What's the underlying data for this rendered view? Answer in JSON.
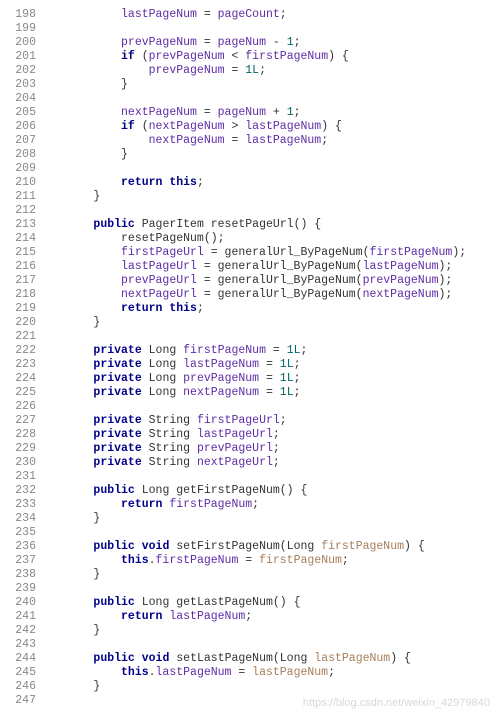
{
  "watermark": "https://blog.csdn.net/weixin_42979840",
  "lines": [
    {
      "num": "198",
      "tokens": [
        {
          "t": "          "
        },
        {
          "t": "lastPageNum",
          "c": "field"
        },
        {
          "t": " = "
        },
        {
          "t": "pageCount",
          "c": "field"
        },
        {
          "t": ";"
        }
      ]
    },
    {
      "num": "199",
      "tokens": []
    },
    {
      "num": "200",
      "tokens": [
        {
          "t": "          "
        },
        {
          "t": "prevPageNum",
          "c": "field"
        },
        {
          "t": " = "
        },
        {
          "t": "pageNum",
          "c": "field"
        },
        {
          "t": " - "
        },
        {
          "t": "1",
          "c": "num"
        },
        {
          "t": ";"
        }
      ]
    },
    {
      "num": "201",
      "tokens": [
        {
          "t": "          "
        },
        {
          "t": "if",
          "c": "kw"
        },
        {
          "t": " ("
        },
        {
          "t": "prevPageNum",
          "c": "field"
        },
        {
          "t": " < "
        },
        {
          "t": "firstPageNum",
          "c": "field"
        },
        {
          "t": ") {"
        }
      ]
    },
    {
      "num": "202",
      "tokens": [
        {
          "t": "              "
        },
        {
          "t": "prevPageNum",
          "c": "field"
        },
        {
          "t": " = "
        },
        {
          "t": "1L",
          "c": "num"
        },
        {
          "t": ";"
        }
      ]
    },
    {
      "num": "203",
      "tokens": [
        {
          "t": "          }"
        }
      ]
    },
    {
      "num": "204",
      "tokens": []
    },
    {
      "num": "205",
      "tokens": [
        {
          "t": "          "
        },
        {
          "t": "nextPageNum",
          "c": "field"
        },
        {
          "t": " = "
        },
        {
          "t": "pageNum",
          "c": "field"
        },
        {
          "t": " + "
        },
        {
          "t": "1",
          "c": "num"
        },
        {
          "t": ";"
        }
      ]
    },
    {
      "num": "206",
      "tokens": [
        {
          "t": "          "
        },
        {
          "t": "if",
          "c": "kw"
        },
        {
          "t": " ("
        },
        {
          "t": "nextPageNum",
          "c": "field"
        },
        {
          "t": " > "
        },
        {
          "t": "lastPageNum",
          "c": "field"
        },
        {
          "t": ") {"
        }
      ]
    },
    {
      "num": "207",
      "tokens": [
        {
          "t": "              "
        },
        {
          "t": "nextPageNum",
          "c": "field"
        },
        {
          "t": " = "
        },
        {
          "t": "lastPageNum",
          "c": "field"
        },
        {
          "t": ";"
        }
      ]
    },
    {
      "num": "208",
      "tokens": [
        {
          "t": "          }"
        }
      ]
    },
    {
      "num": "209",
      "tokens": []
    },
    {
      "num": "210",
      "tokens": [
        {
          "t": "          "
        },
        {
          "t": "return",
          "c": "kw"
        },
        {
          "t": " "
        },
        {
          "t": "this",
          "c": "kw"
        },
        {
          "t": ";"
        }
      ]
    },
    {
      "num": "211",
      "tokens": [
        {
          "t": "      }"
        }
      ]
    },
    {
      "num": "212",
      "tokens": []
    },
    {
      "num": "213",
      "tokens": [
        {
          "t": "      "
        },
        {
          "t": "public",
          "c": "kw"
        },
        {
          "t": " PagerItem resetPageUrl() {"
        }
      ]
    },
    {
      "num": "214",
      "tokens": [
        {
          "t": "          resetPageNum();"
        }
      ]
    },
    {
      "num": "215",
      "tokens": [
        {
          "t": "          "
        },
        {
          "t": "firstPageUrl",
          "c": "field"
        },
        {
          "t": " = generalUrl_ByPageNum("
        },
        {
          "t": "firstPageNum",
          "c": "field"
        },
        {
          "t": ");"
        }
      ]
    },
    {
      "num": "216",
      "tokens": [
        {
          "t": "          "
        },
        {
          "t": "lastPageUrl",
          "c": "field"
        },
        {
          "t": " = generalUrl_ByPageNum("
        },
        {
          "t": "lastPageNum",
          "c": "field"
        },
        {
          "t": ");"
        }
      ]
    },
    {
      "num": "217",
      "tokens": [
        {
          "t": "          "
        },
        {
          "t": "prevPageUrl",
          "c": "field"
        },
        {
          "t": " = generalUrl_ByPageNum("
        },
        {
          "t": "prevPageNum",
          "c": "field"
        },
        {
          "t": ");"
        }
      ]
    },
    {
      "num": "218",
      "tokens": [
        {
          "t": "          "
        },
        {
          "t": "nextPageUrl",
          "c": "field"
        },
        {
          "t": " = generalUrl_ByPageNum("
        },
        {
          "t": "nextPageNum",
          "c": "field"
        },
        {
          "t": ");"
        }
      ]
    },
    {
      "num": "219",
      "tokens": [
        {
          "t": "          "
        },
        {
          "t": "return",
          "c": "kw"
        },
        {
          "t": " "
        },
        {
          "t": "this",
          "c": "kw"
        },
        {
          "t": ";"
        }
      ]
    },
    {
      "num": "220",
      "tokens": [
        {
          "t": "      }"
        }
      ]
    },
    {
      "num": "221",
      "tokens": []
    },
    {
      "num": "222",
      "tokens": [
        {
          "t": "      "
        },
        {
          "t": "private",
          "c": "kw"
        },
        {
          "t": " Long "
        },
        {
          "t": "firstPageNum",
          "c": "field"
        },
        {
          "t": " = "
        },
        {
          "t": "1L",
          "c": "num"
        },
        {
          "t": ";"
        }
      ]
    },
    {
      "num": "223",
      "tokens": [
        {
          "t": "      "
        },
        {
          "t": "private",
          "c": "kw"
        },
        {
          "t": " Long "
        },
        {
          "t": "lastPageNum",
          "c": "field"
        },
        {
          "t": " = "
        },
        {
          "t": "1L",
          "c": "num"
        },
        {
          "t": ";"
        }
      ]
    },
    {
      "num": "224",
      "tokens": [
        {
          "t": "      "
        },
        {
          "t": "private",
          "c": "kw"
        },
        {
          "t": " Long "
        },
        {
          "t": "prevPageNum",
          "c": "field"
        },
        {
          "t": " = "
        },
        {
          "t": "1L",
          "c": "num"
        },
        {
          "t": ";"
        }
      ]
    },
    {
      "num": "225",
      "tokens": [
        {
          "t": "      "
        },
        {
          "t": "private",
          "c": "kw"
        },
        {
          "t": " Long "
        },
        {
          "t": "nextPageNum",
          "c": "field"
        },
        {
          "t": " = "
        },
        {
          "t": "1L",
          "c": "num"
        },
        {
          "t": ";"
        }
      ]
    },
    {
      "num": "226",
      "tokens": []
    },
    {
      "num": "227",
      "tokens": [
        {
          "t": "      "
        },
        {
          "t": "private",
          "c": "kw"
        },
        {
          "t": " String "
        },
        {
          "t": "firstPageUrl",
          "c": "field"
        },
        {
          "t": ";"
        }
      ]
    },
    {
      "num": "228",
      "tokens": [
        {
          "t": "      "
        },
        {
          "t": "private",
          "c": "kw"
        },
        {
          "t": " String "
        },
        {
          "t": "lastPageUrl",
          "c": "field"
        },
        {
          "t": ";"
        }
      ]
    },
    {
      "num": "229",
      "tokens": [
        {
          "t": "      "
        },
        {
          "t": "private",
          "c": "kw"
        },
        {
          "t": " String "
        },
        {
          "t": "prevPageUrl",
          "c": "field"
        },
        {
          "t": ";"
        }
      ]
    },
    {
      "num": "230",
      "tokens": [
        {
          "t": "      "
        },
        {
          "t": "private",
          "c": "kw"
        },
        {
          "t": " String "
        },
        {
          "t": "nextPageUrl",
          "c": "field"
        },
        {
          "t": ";"
        }
      ]
    },
    {
      "num": "231",
      "tokens": []
    },
    {
      "num": "232",
      "tokens": [
        {
          "t": "      "
        },
        {
          "t": "public",
          "c": "kw"
        },
        {
          "t": " Long getFirstPageNum() {"
        }
      ]
    },
    {
      "num": "233",
      "tokens": [
        {
          "t": "          "
        },
        {
          "t": "return",
          "c": "kw"
        },
        {
          "t": " "
        },
        {
          "t": "firstPageNum",
          "c": "field"
        },
        {
          "t": ";"
        }
      ]
    },
    {
      "num": "234",
      "tokens": [
        {
          "t": "      }"
        }
      ]
    },
    {
      "num": "235",
      "tokens": []
    },
    {
      "num": "236",
      "tokens": [
        {
          "t": "      "
        },
        {
          "t": "public",
          "c": "kw"
        },
        {
          "t": " "
        },
        {
          "t": "void",
          "c": "kw"
        },
        {
          "t": " setFirstPageNum(Long "
        },
        {
          "t": "firstPageNum",
          "c": "param"
        },
        {
          "t": ") {"
        }
      ]
    },
    {
      "num": "237",
      "tokens": [
        {
          "t": "          "
        },
        {
          "t": "this",
          "c": "kw"
        },
        {
          "t": "."
        },
        {
          "t": "firstPageNum",
          "c": "field"
        },
        {
          "t": " = "
        },
        {
          "t": "firstPageNum",
          "c": "param"
        },
        {
          "t": ";"
        }
      ]
    },
    {
      "num": "238",
      "tokens": [
        {
          "t": "      }"
        }
      ]
    },
    {
      "num": "239",
      "tokens": []
    },
    {
      "num": "240",
      "tokens": [
        {
          "t": "      "
        },
        {
          "t": "public",
          "c": "kw"
        },
        {
          "t": " Long getLastPageNum() {"
        }
      ]
    },
    {
      "num": "241",
      "tokens": [
        {
          "t": "          "
        },
        {
          "t": "return",
          "c": "kw"
        },
        {
          "t": " "
        },
        {
          "t": "lastPageNum",
          "c": "field"
        },
        {
          "t": ";"
        }
      ]
    },
    {
      "num": "242",
      "tokens": [
        {
          "t": "      }"
        }
      ]
    },
    {
      "num": "243",
      "tokens": []
    },
    {
      "num": "244",
      "tokens": [
        {
          "t": "      "
        },
        {
          "t": "public",
          "c": "kw"
        },
        {
          "t": " "
        },
        {
          "t": "void",
          "c": "kw"
        },
        {
          "t": " setLastPageNum(Long "
        },
        {
          "t": "lastPageNum",
          "c": "param"
        },
        {
          "t": ") {"
        }
      ]
    },
    {
      "num": "245",
      "tokens": [
        {
          "t": "          "
        },
        {
          "t": "this",
          "c": "kw"
        },
        {
          "t": "."
        },
        {
          "t": "lastPageNum",
          "c": "field"
        },
        {
          "t": " = "
        },
        {
          "t": "lastPageNum",
          "c": "param"
        },
        {
          "t": ";"
        }
      ]
    },
    {
      "num": "246",
      "tokens": [
        {
          "t": "      }"
        }
      ]
    },
    {
      "num": "247",
      "tokens": []
    }
  ]
}
